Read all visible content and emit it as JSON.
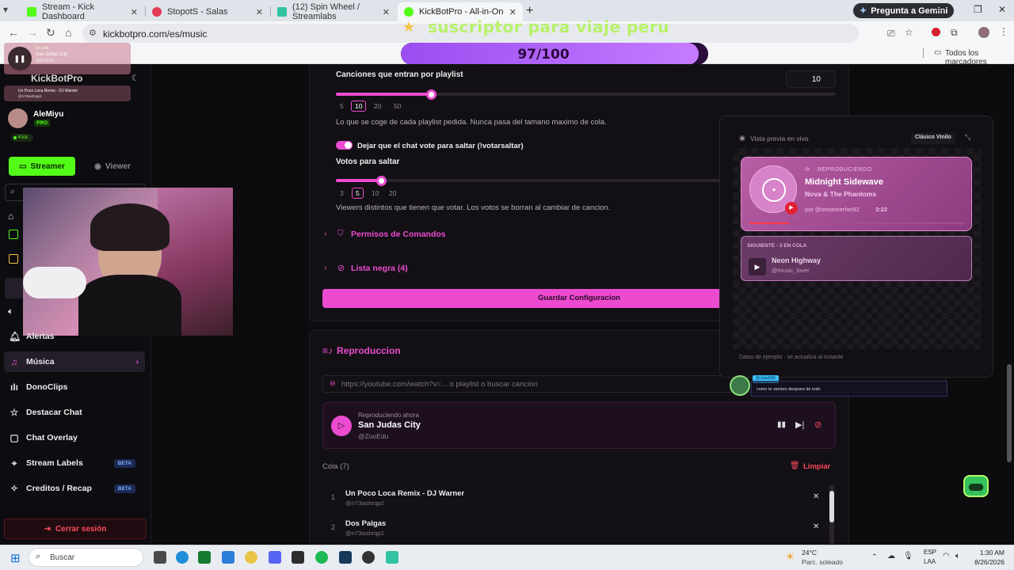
{
  "tabs": [
    {
      "title": "Stream - Kick Dashboard",
      "color": "#53fc18"
    },
    {
      "title": "StopotS - Salas",
      "color": "#e23b52"
    },
    {
      "title": "(12) Spin Wheel / Streamlabs",
      "color": "#31c3a2"
    },
    {
      "title": "KickBotPro - All-in-One Stream",
      "color": "#53fc18"
    }
  ],
  "gemini_label": "Pregunta a Gemini",
  "url": "kickbotpro.com/es/music",
  "bookmarks_label": "Todos los marcadores",
  "sub_goal": {
    "text": "suscriptor para viaje peru",
    "progress": "97/100",
    "current": 97,
    "target": 100
  },
  "mini_player": {
    "status": "En vivo",
    "track": "San Judas City",
    "artist": "@ZooEdu",
    "next": "Un Poco Loca Remix - DJ Warner",
    "next_user": "@n73iashrqp2"
  },
  "sidebar": {
    "brand": "KickBotPro",
    "user": "AleMiyu",
    "plan": "PRO",
    "platform": "Kick",
    "mode_streamer": "Streamer",
    "mode_viewer": "Viewer",
    "items": [
      {
        "label": "Alertas",
        "icon": "bell-icon"
      },
      {
        "label": "Música",
        "icon": "music-icon"
      },
      {
        "label": "DonoClips",
        "icon": "bars-icon"
      },
      {
        "label": "Destacar Chat",
        "icon": "star-icon"
      },
      {
        "label": "Chat Overlay",
        "icon": "chat-icon"
      },
      {
        "label": "Stream Labels",
        "icon": "label-icon",
        "badge": "BETA"
      },
      {
        "label": "Creditos / Recap",
        "icon": "credits-icon",
        "badge": "BETA"
      }
    ],
    "logout": "Cerrar sesión"
  },
  "settings": {
    "songs_per_playlist_label": "Canciones que entran por playlist",
    "songs_per_playlist_value": "10",
    "songs_ticks": [
      "5",
      "10",
      "20",
      "50"
    ],
    "songs_selected": "10",
    "songs_help": "Lo que se coge de cada playlist pedida. Nunca pasa del tamano maximo de cola.",
    "vote_toggle_label": "Dejar que el chat vote para saltar (!votarsaltar)",
    "votes_label": "Votos para saltar",
    "votes_ticks": [
      "3",
      "5",
      "10",
      "20"
    ],
    "votes_selected": "5",
    "votes_help": "Viewers distintos que tienen que votar. Los votos se borran al cambiar de cancion.",
    "commands_perm": "Permisos de Comandos",
    "blacklist": "Lista negra (4)",
    "save": "Guardar Configuracion"
  },
  "playback": {
    "title": "Reproduccion",
    "input_placeholder": "https://youtube.com/watch?v=... o playlist o buscar cancion",
    "now_label": "Reproduciendo ahora",
    "now_track": "San Judas City",
    "now_artist": "@ZooEdu",
    "queue_label": "Cola (7)",
    "clear": "Limpiar",
    "queue": [
      {
        "n": "1",
        "title": "Un Poco Loca Remix - DJ Warner",
        "user": "@n73iashrqp2"
      },
      {
        "n": "2",
        "title": "Dos Palgas",
        "user": "@n73iashrqp2"
      }
    ]
  },
  "preview": {
    "title": "Vista previa en vivo",
    "theme": "Clásico Vinilo",
    "playing_label": "REPRODUCIENDO",
    "track": "Midnight Sidewave",
    "artist": "Nova & The Phantoms",
    "requester": "por @streamerfan92",
    "time": "3:22",
    "next_label": "SIGUIENTE - 3 EN COLA",
    "next_track": "Neon Highway",
    "next_user": "@music_lover",
    "footer": "Datos de ejemplo · se actualiza al instante"
  },
  "chat_overlay": {
    "user": "@JudaD89",
    "text": "como te sientes despues de todo"
  },
  "taskbar": {
    "search": "Buscar",
    "weather_temp": "24°C",
    "weather_desc": "Parc. soleado",
    "lang": "ESP",
    "lang2": "LAA",
    "time": "1:30 AM",
    "date": "8/26/2026"
  }
}
